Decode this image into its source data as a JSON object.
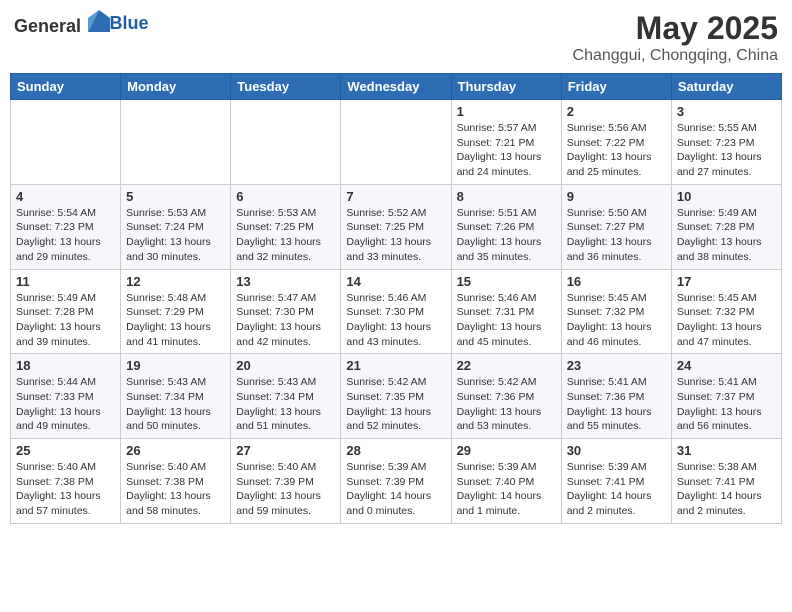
{
  "header": {
    "logo_general": "General",
    "logo_blue": "Blue",
    "title": "May 2025",
    "location": "Changgui, Chongqing, China"
  },
  "weekdays": [
    "Sunday",
    "Monday",
    "Tuesday",
    "Wednesday",
    "Thursday",
    "Friday",
    "Saturday"
  ],
  "weeks": [
    [
      {
        "day": "",
        "info": ""
      },
      {
        "day": "",
        "info": ""
      },
      {
        "day": "",
        "info": ""
      },
      {
        "day": "",
        "info": ""
      },
      {
        "day": "1",
        "info": "Sunrise: 5:57 AM\nSunset: 7:21 PM\nDaylight: 13 hours\nand 24 minutes."
      },
      {
        "day": "2",
        "info": "Sunrise: 5:56 AM\nSunset: 7:22 PM\nDaylight: 13 hours\nand 25 minutes."
      },
      {
        "day": "3",
        "info": "Sunrise: 5:55 AM\nSunset: 7:23 PM\nDaylight: 13 hours\nand 27 minutes."
      }
    ],
    [
      {
        "day": "4",
        "info": "Sunrise: 5:54 AM\nSunset: 7:23 PM\nDaylight: 13 hours\nand 29 minutes."
      },
      {
        "day": "5",
        "info": "Sunrise: 5:53 AM\nSunset: 7:24 PM\nDaylight: 13 hours\nand 30 minutes."
      },
      {
        "day": "6",
        "info": "Sunrise: 5:53 AM\nSunset: 7:25 PM\nDaylight: 13 hours\nand 32 minutes."
      },
      {
        "day": "7",
        "info": "Sunrise: 5:52 AM\nSunset: 7:25 PM\nDaylight: 13 hours\nand 33 minutes."
      },
      {
        "day": "8",
        "info": "Sunrise: 5:51 AM\nSunset: 7:26 PM\nDaylight: 13 hours\nand 35 minutes."
      },
      {
        "day": "9",
        "info": "Sunrise: 5:50 AM\nSunset: 7:27 PM\nDaylight: 13 hours\nand 36 minutes."
      },
      {
        "day": "10",
        "info": "Sunrise: 5:49 AM\nSunset: 7:28 PM\nDaylight: 13 hours\nand 38 minutes."
      }
    ],
    [
      {
        "day": "11",
        "info": "Sunrise: 5:49 AM\nSunset: 7:28 PM\nDaylight: 13 hours\nand 39 minutes."
      },
      {
        "day": "12",
        "info": "Sunrise: 5:48 AM\nSunset: 7:29 PM\nDaylight: 13 hours\nand 41 minutes."
      },
      {
        "day": "13",
        "info": "Sunrise: 5:47 AM\nSunset: 7:30 PM\nDaylight: 13 hours\nand 42 minutes."
      },
      {
        "day": "14",
        "info": "Sunrise: 5:46 AM\nSunset: 7:30 PM\nDaylight: 13 hours\nand 43 minutes."
      },
      {
        "day": "15",
        "info": "Sunrise: 5:46 AM\nSunset: 7:31 PM\nDaylight: 13 hours\nand 45 minutes."
      },
      {
        "day": "16",
        "info": "Sunrise: 5:45 AM\nSunset: 7:32 PM\nDaylight: 13 hours\nand 46 minutes."
      },
      {
        "day": "17",
        "info": "Sunrise: 5:45 AM\nSunset: 7:32 PM\nDaylight: 13 hours\nand 47 minutes."
      }
    ],
    [
      {
        "day": "18",
        "info": "Sunrise: 5:44 AM\nSunset: 7:33 PM\nDaylight: 13 hours\nand 49 minutes."
      },
      {
        "day": "19",
        "info": "Sunrise: 5:43 AM\nSunset: 7:34 PM\nDaylight: 13 hours\nand 50 minutes."
      },
      {
        "day": "20",
        "info": "Sunrise: 5:43 AM\nSunset: 7:34 PM\nDaylight: 13 hours\nand 51 minutes."
      },
      {
        "day": "21",
        "info": "Sunrise: 5:42 AM\nSunset: 7:35 PM\nDaylight: 13 hours\nand 52 minutes."
      },
      {
        "day": "22",
        "info": "Sunrise: 5:42 AM\nSunset: 7:36 PM\nDaylight: 13 hours\nand 53 minutes."
      },
      {
        "day": "23",
        "info": "Sunrise: 5:41 AM\nSunset: 7:36 PM\nDaylight: 13 hours\nand 55 minutes."
      },
      {
        "day": "24",
        "info": "Sunrise: 5:41 AM\nSunset: 7:37 PM\nDaylight: 13 hours\nand 56 minutes."
      }
    ],
    [
      {
        "day": "25",
        "info": "Sunrise: 5:40 AM\nSunset: 7:38 PM\nDaylight: 13 hours\nand 57 minutes."
      },
      {
        "day": "26",
        "info": "Sunrise: 5:40 AM\nSunset: 7:38 PM\nDaylight: 13 hours\nand 58 minutes."
      },
      {
        "day": "27",
        "info": "Sunrise: 5:40 AM\nSunset: 7:39 PM\nDaylight: 13 hours\nand 59 minutes."
      },
      {
        "day": "28",
        "info": "Sunrise: 5:39 AM\nSunset: 7:39 PM\nDaylight: 14 hours\nand 0 minutes."
      },
      {
        "day": "29",
        "info": "Sunrise: 5:39 AM\nSunset: 7:40 PM\nDaylight: 14 hours\nand 1 minute."
      },
      {
        "day": "30",
        "info": "Sunrise: 5:39 AM\nSunset: 7:41 PM\nDaylight: 14 hours\nand 2 minutes."
      },
      {
        "day": "31",
        "info": "Sunrise: 5:38 AM\nSunset: 7:41 PM\nDaylight: 14 hours\nand 2 minutes."
      }
    ]
  ]
}
